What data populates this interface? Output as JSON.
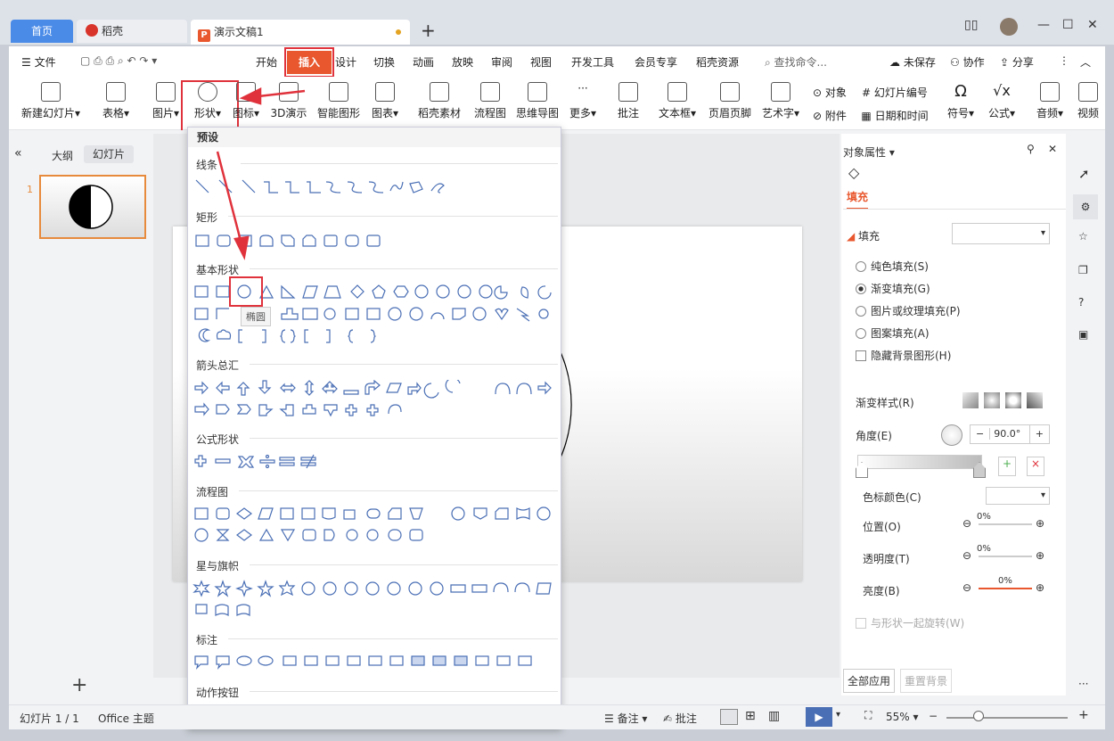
{
  "tabs": {
    "home": "首页",
    "daoke": "稻壳",
    "doc": "演示文稿1",
    "doc_icon": "P"
  },
  "menu": {
    "file": "文件",
    "items": [
      "开始",
      "插入",
      "设计",
      "切换",
      "动画",
      "放映",
      "审阅",
      "视图",
      "开发工具",
      "会员专享",
      "稻壳资源"
    ],
    "search": "查找命令...",
    "unsaved": "未保存",
    "collab": "协作",
    "share": "分享"
  },
  "ribbon": [
    "新建幻灯片",
    "表格",
    "图片",
    "形状",
    "图标",
    "3D演示",
    "智能图形",
    "图表",
    "稻壳素材",
    "流程图",
    "思维导图",
    "更多",
    "批注",
    "文本框",
    "页眉页脚",
    "艺术字",
    "符号",
    "公式",
    "音频",
    "视频"
  ],
  "ribbon_small": {
    "obj": "对象",
    "attach": "附件",
    "slide_num": "幻灯片编号",
    "date": "日期和时间"
  },
  "left": {
    "outline": "大纲",
    "slides": "幻灯片",
    "slide_num": "1"
  },
  "dropdown": {
    "preset": "预设",
    "sections": [
      "线条",
      "矩形",
      "基本形状",
      "箭头总汇",
      "公式形状",
      "流程图",
      "星与旗帜",
      "标注",
      "动作按钮"
    ],
    "tooltip": "椭圆"
  },
  "right": {
    "title": "对象属性",
    "fill_tab": "填充",
    "fill_header": "填充",
    "options": [
      "纯色填充(S)",
      "渐变填充(G)",
      "图片或纹理填充(P)",
      "图案填充(A)"
    ],
    "hide_bg": "隐藏背景图形(H)",
    "grad_style": "渐变样式(R)",
    "angle_label": "角度(E)",
    "angle_value": "90.0°",
    "color_stop": "色标颜色(C)",
    "position": "位置(O)",
    "transparency": "透明度(T)",
    "brightness": "亮度(B)",
    "pct1": "0%",
    "pct2": "0%",
    "pct3": "0%",
    "rotate": "与形状一起旋转(W)",
    "apply_all": "全部应用",
    "reset_bg": "重置背景"
  },
  "status": {
    "slide": "幻灯片 1 / 1",
    "theme": "Office 主题",
    "notes": "备注",
    "comment": "批注",
    "zoom": "55%"
  },
  "colors": {
    "accent": "#e8572d",
    "blue": "#4a8be8",
    "red_box": "#e0323c"
  }
}
